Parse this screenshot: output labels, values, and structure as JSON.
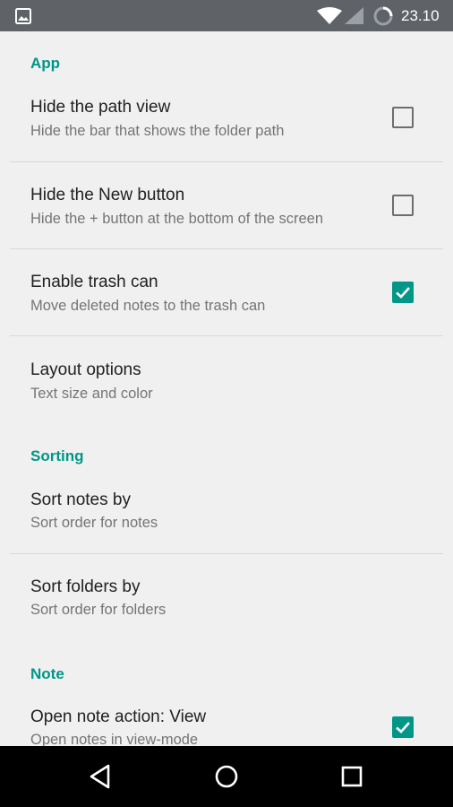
{
  "status_bar": {
    "time": "23.10",
    "icons": [
      "image-icon",
      "wifi-icon",
      "signal-icon",
      "battery-loading-icon"
    ]
  },
  "sections": {
    "app": "App",
    "sorting": "Sorting",
    "note": "Note"
  },
  "prefs": {
    "hide_path": {
      "title": "Hide the path view",
      "summary": "Hide the bar that shows the folder path",
      "checked": false
    },
    "hide_new": {
      "title": "Hide the New button",
      "summary": "Hide the + button at the bottom of the screen",
      "checked": false
    },
    "trash": {
      "title": "Enable trash can",
      "summary": "Move deleted notes to the trash can",
      "checked": true
    },
    "layout": {
      "title": "Layout options",
      "summary": "Text size and color"
    },
    "sort_notes": {
      "title": "Sort notes by",
      "summary": "Sort order for notes"
    },
    "sort_folders": {
      "title": "Sort folders by",
      "summary": "Sort order for folders"
    },
    "open_note": {
      "title": "Open note action: View",
      "summary": "Open notes in view-mode",
      "checked": true
    }
  },
  "colors": {
    "accent": "#009688",
    "status_bar": "#5f6368",
    "nav_bar": "#000000"
  },
  "nav_bar": {
    "icons": [
      "back-icon",
      "home-icon",
      "recents-icon"
    ]
  }
}
